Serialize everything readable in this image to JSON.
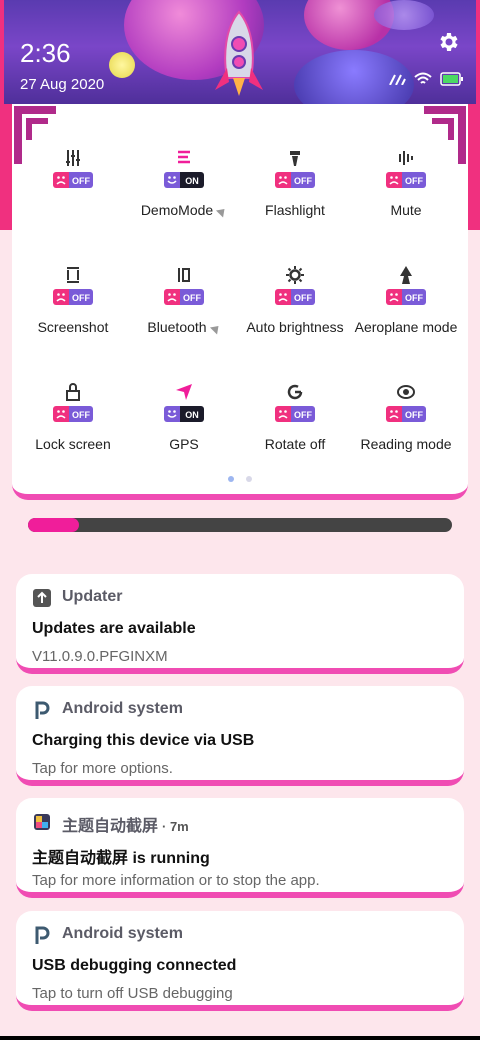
{
  "status": {
    "time": "2:36",
    "date": "27 Aug 2020"
  },
  "tiles": [
    {
      "label": "",
      "state": "OFF",
      "icon": "sliders-icon"
    },
    {
      "label": "DemoMode",
      "state": "ON",
      "icon": "list-icon",
      "expandable": true
    },
    {
      "label": "Flashlight",
      "state": "OFF",
      "icon": "flashlight-icon"
    },
    {
      "label": "Mute",
      "state": "OFF",
      "icon": "mute-icon"
    },
    {
      "label": "Screenshot",
      "state": "OFF",
      "icon": "screenshot-icon"
    },
    {
      "label": "Bluetooth",
      "state": "OFF",
      "icon": "bluetooth-icon",
      "expandable": true
    },
    {
      "label": "Auto brightness",
      "state": "OFF",
      "icon": "brightness-icon"
    },
    {
      "label": "Aeroplane mode",
      "state": "OFF",
      "icon": "aeroplane-icon"
    },
    {
      "label": "Lock screen",
      "state": "OFF",
      "icon": "lock-icon"
    },
    {
      "label": "GPS",
      "state": "ON",
      "icon": "gps-icon"
    },
    {
      "label": "Rotate off",
      "state": "OFF",
      "icon": "rotate-icon"
    },
    {
      "label": "Reading mode",
      "state": "OFF",
      "icon": "eye-icon"
    }
  ],
  "brightness": {
    "level_percent": 12
  },
  "colors": {
    "accent": "#f04cb3",
    "on": "#7a5bd8",
    "off": "#f0307f"
  },
  "notifications": [
    {
      "app": "Updater",
      "meta": "",
      "title": "Updates are available",
      "body": "V11.0.9.0.PFGINXM",
      "icon": "updater-icon"
    },
    {
      "app": "Android system",
      "meta": "",
      "title": "Charging this device via USB",
      "body": "Tap for more options.",
      "icon": "android-system-icon"
    },
    {
      "app": "主题自动截屏",
      "meta": "· 7m",
      "title": "主题自动截屏 is running",
      "body": "Tap for more information or to stop the app.",
      "icon": "app-icon"
    },
    {
      "app": "Android system",
      "meta": "",
      "title": "USB debugging connected",
      "body": "Tap to turn off USB debugging",
      "icon": "android-system-icon"
    }
  ]
}
